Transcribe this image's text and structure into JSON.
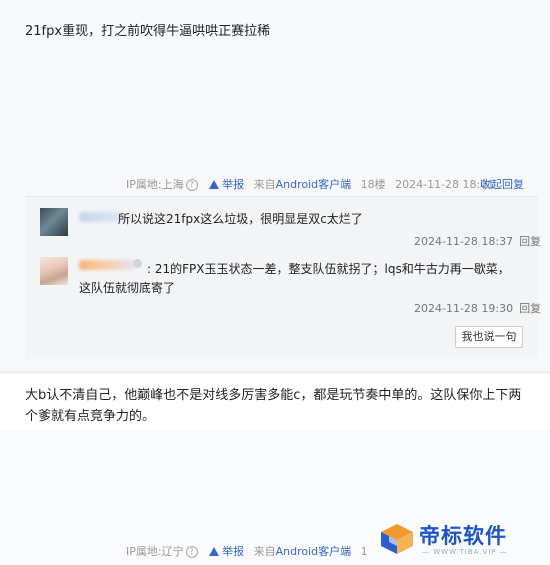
{
  "post1": {
    "text": "21fpx重现，打之前吹得牛逼哄哄正赛拉稀",
    "meta": {
      "ip": "IP属地:上海",
      "report": "举报",
      "client": "来自Android客户端",
      "floor": "18楼",
      "time": "2024-11-28 18:01",
      "collapse": "收起回复"
    }
  },
  "replies": [
    {
      "text": "所以说这21fpx这么垃圾，很明显是双c太烂了",
      "time": "2024-11-28 18:37",
      "reply": "回复"
    },
    {
      "text_line1": ": 21的FPX玉玉状态一差，整支队伍就拐了；lqs和牛古力再一歇菜，",
      "text_line2": "这队伍就彻底寄了",
      "time": "2024-11-28 19:30",
      "reply": "回复"
    }
  ],
  "say_button": "我也说一句",
  "post2": {
    "text": "大b认不清自己，他巅峰也不是对线多厉害多能c，都是玩节奏中单的。这队保你上下两个爹就有点竞争力的。",
    "meta": {
      "ip": "IP属地:辽宁",
      "report": "举报",
      "client": "来自Android客户端",
      "floor": "1"
    }
  },
  "watermark": {
    "brand": "帝标软件",
    "sub": "— WWW.TIBA.VIP —"
  },
  "colors": {
    "link": "#3467c8",
    "brand": "#1f54c4"
  }
}
